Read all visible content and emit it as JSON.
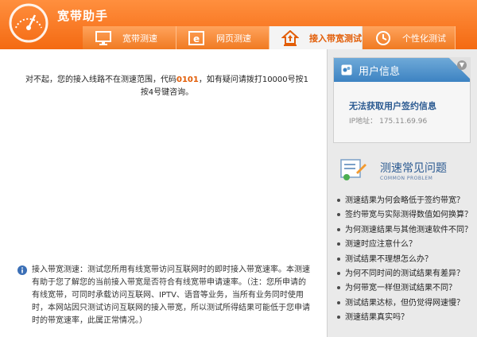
{
  "app": {
    "title": "宽带助手"
  },
  "tabs": [
    {
      "label": "宽带测速",
      "icon": "monitor-icon",
      "active": false
    },
    {
      "label": "网页测速",
      "icon": "browser-e-icon",
      "active": false
    },
    {
      "label": "接入带宽测试",
      "icon": "home-upload-icon",
      "active": true
    },
    {
      "label": "个性化测试",
      "icon": "clock-icon",
      "active": false
    }
  ],
  "main": {
    "message_prefix": "对不起，您的接入线路不在测速范围，代码",
    "message_code": "0101",
    "message_suffix": "，如有疑问请拨打10000号按1按4号键咨询。",
    "note": "接入带宽测速：测试您所用有线宽带访问互联网时的即时接入带宽速率。本测速有助于您了解您的当前接入带宽是否符合有线宽带申请速率。（注：您所申请的有线宽带，可同时承载访问互联网、IPTV、语音等业务，当所有业务同时使用时，本网站因只测试访问互联网的接入带宽，所以测试所得结果可能低于您申请时的带宽速率，此属正常情况。）"
  },
  "user_info": {
    "title": "用户信息",
    "status": "无法获取用户签约信息",
    "ip_label": "IP地址：",
    "ip": "175.11.69.96"
  },
  "faq": {
    "title": "测速常见问题",
    "subtitle": "COMMON PROBLEM",
    "items": [
      "测速结果为何会略低于签约带宽？",
      "签约带宽与实际测得数值如何换算？",
      "为何测速结果与其他测速软件不同？",
      "测速时应注意什么？",
      "测试结果不理想怎么办？",
      "为何不同时间的测试结果有差异？",
      "为何带宽一样但测试结果不同？",
      "测试结果达标，但仍觉得网速慢？",
      "测速结果真实吗？"
    ]
  },
  "colors": {
    "brand_orange": "#f46a12",
    "link_blue": "#2b5a91",
    "code_orange": "#e25d06"
  }
}
